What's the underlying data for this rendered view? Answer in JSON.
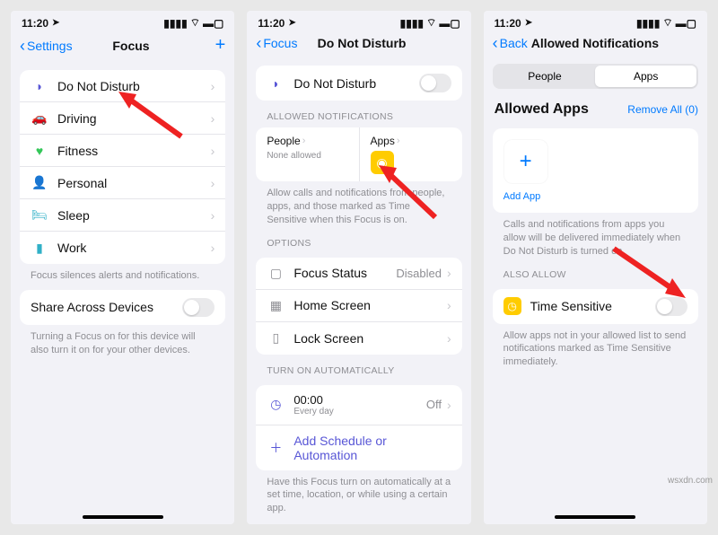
{
  "status": {
    "time": "11:20",
    "loc_glyph": "➤"
  },
  "screen1": {
    "back": "Settings",
    "title": "Focus",
    "items": [
      {
        "icon": "🌙",
        "label": "Do Not Disturb"
      },
      {
        "icon": "🚗",
        "label": "Driving"
      },
      {
        "icon": "🏃",
        "label": "Fitness"
      },
      {
        "icon": "👤",
        "label": "Personal"
      },
      {
        "icon": "🛏",
        "label": "Sleep"
      },
      {
        "icon": "💼",
        "label": "Work"
      }
    ],
    "footer1": "Focus silences alerts and notifications.",
    "share_label": "Share Across Devices",
    "footer2": "Turning a Focus on for this device will also turn it on for your other devices."
  },
  "screen2": {
    "back": "Focus",
    "title": "Do Not Disturb",
    "dnd_label": "Do Not Disturb",
    "allowed_header": "ALLOWED NOTIFICATIONS",
    "people_label": "People",
    "people_sub": "None allowed",
    "apps_label": "Apps",
    "allowed_footer": "Allow calls and notifications from people, apps, and those marked as Time Sensitive when this Focus is on.",
    "options_header": "OPTIONS",
    "focus_status": "Focus Status",
    "focus_status_value": "Disabled",
    "home_screen": "Home Screen",
    "lock_screen": "Lock Screen",
    "auto_header": "TURN ON AUTOMATICALLY",
    "time_label": "00:00",
    "time_sub": "Every day",
    "time_value": "Off",
    "add_schedule": "Add Schedule or Automation",
    "auto_footer": "Have this Focus turn on automatically at a set time, location, or while using a certain app."
  },
  "screen3": {
    "back": "Back",
    "title": "Allowed Notifications",
    "seg_people": "People",
    "seg_apps": "Apps",
    "allowed_apps": "Allowed Apps",
    "remove_all": "Remove All (0)",
    "add_app": "Add App",
    "apps_footer": "Calls and notifications from apps you allow will be delivered immediately when Do Not Disturb is turned on.",
    "also_allow": "ALSO ALLOW",
    "time_sensitive": "Time Sensitive",
    "ts_footer": "Allow apps not in your allowed list to send notifications marked as Time Sensitive immediately."
  },
  "watermark": "wsxdn.com"
}
